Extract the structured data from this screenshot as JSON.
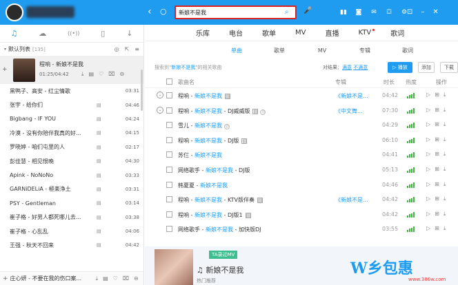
{
  "search": {
    "value": "新娘不是我"
  },
  "left_tabs": [
    "♫",
    "☁",
    "((•))",
    "▯",
    "↓"
  ],
  "playlist": {
    "title": "默认列表",
    "count": "[135]"
  },
  "now_playing": {
    "song": "程响 - 新娘不是我",
    "time": "01:25/04:42"
  },
  "left_list": [
    {
      "name": "黑鸭子、高安 - 红尘情歌",
      "dur": "03:31",
      "mv": false
    },
    {
      "name": "张宇 - 给你们",
      "dur": "04:46",
      "mv": true
    },
    {
      "name": "Bigbang - IF YOU",
      "dur": "04:24",
      "mv": true
    },
    {
      "name": "冷漠 - 没有你陪伴我真的好...",
      "dur": "04:15",
      "mv": true
    },
    {
      "name": "罗晓婷 - 咱们屯里的人",
      "dur": "02:17",
      "mv": true
    },
    {
      "name": "彭佳慧 - 相见恨晚",
      "dur": "04:30",
      "mv": true
    },
    {
      "name": "Apink - NoNoNo",
      "dur": "03:33",
      "mv": true
    },
    {
      "name": "GARNiDELiA - 極楽浄土",
      "dur": "03:31",
      "mv": true
    },
    {
      "name": "PSY - Gentleman",
      "dur": "03:14",
      "mv": true
    },
    {
      "name": "崔子格 - 好男人都死哪儿去...",
      "dur": "03:38",
      "mv": true
    },
    {
      "name": "崔子格 - 心乱乱",
      "dur": "04:06",
      "mv": true
    },
    {
      "name": "王强 - 秋天不回来",
      "dur": "04:42",
      "mv": true
    }
  ],
  "left_bottom": {
    "name": "庄心妍 - 不要在我的伤口案..."
  },
  "main_tabs": [
    "乐库",
    "电台",
    "歌单",
    "MV",
    "直播",
    "KTV",
    "歌词"
  ],
  "sub_tabs": [
    "单曲",
    "歌单",
    "MV",
    "专辑",
    "歌词"
  ],
  "result": {
    "prefix": "搜索到\"",
    "keyword": "新娘不是我",
    "suffix": "\"的相关歌曲",
    "compare_label": "对结果：",
    "compare_ok": "满意",
    "compare_bad": "不满意"
  },
  "buttons": {
    "play": "播放",
    "add": "添加",
    "download": "下载"
  },
  "table_head": {
    "song": "歌曲名",
    "album": "专辑",
    "duration": "时长",
    "heat": "热度",
    "ops": "操作"
  },
  "songs": [
    {
      "artist": "程响",
      "title": "新娘不是我",
      "rest": "",
      "mv": true,
      "hq": false,
      "album": "《新娘不是...",
      "dur": "04:42",
      "heat": 4,
      "expand": true
    },
    {
      "artist": "程响",
      "title": "新娘不是我",
      "rest": " - DJ威威版",
      "mv": true,
      "hq": true,
      "album": "《中文舞...",
      "dur": "07:30",
      "heat": 4,
      "expand": true
    },
    {
      "artist": "雪儿",
      "title": "新娘不是我",
      "rest": "",
      "mv": false,
      "hq": true,
      "album": "",
      "dur": "04:29",
      "heat": 4,
      "expand": false
    },
    {
      "artist": "程响",
      "title": "新娘不是我",
      "rest": " - DJ版",
      "mv": true,
      "hq": false,
      "album": "",
      "dur": "06:10",
      "heat": 4,
      "expand": false
    },
    {
      "artist": "苏仨",
      "title": "新娘不是我",
      "rest": "",
      "mv": false,
      "hq": false,
      "album": "",
      "dur": "04:41",
      "heat": 4,
      "expand": false
    },
    {
      "artist": "网络歌手",
      "title": "新娘不是我",
      "rest": " - DJ版",
      "mv": false,
      "hq": false,
      "album": "",
      "dur": "05:13",
      "heat": 4,
      "expand": false
    },
    {
      "artist": "韩夏夏",
      "title": "新娘不是我",
      "rest": "",
      "mv": false,
      "hq": false,
      "album": "",
      "dur": "04:46",
      "heat": 4,
      "expand": false
    },
    {
      "artist": "程响",
      "title": "新娘不是我",
      "rest": " - KTV版伴奏",
      "mv": true,
      "hq": false,
      "album": "《新娘不是...",
      "dur": "04:42",
      "heat": 4,
      "expand": false
    },
    {
      "artist": "程响",
      "title": "新娘不是我",
      "rest": " - DJ版1",
      "mv": true,
      "hq": false,
      "album": "",
      "dur": "04:42",
      "heat": 4,
      "expand": false
    },
    {
      "artist": "网络歌手",
      "title": "新娘不是我",
      "rest": " - 加快版DJ",
      "mv": false,
      "hq": false,
      "album": "",
      "dur": "03:55",
      "heat": 4,
      "expand": false
    }
  ],
  "bottom_card": {
    "badge": "TA录过MV",
    "song": "新娘不是我",
    "sub": "热门推荐"
  },
  "watermark": {
    "logo": "W乡包惠",
    "url": "www.386w.com"
  },
  "colors": {
    "accent": "#1f9cf0",
    "highlight": "#e02020"
  }
}
